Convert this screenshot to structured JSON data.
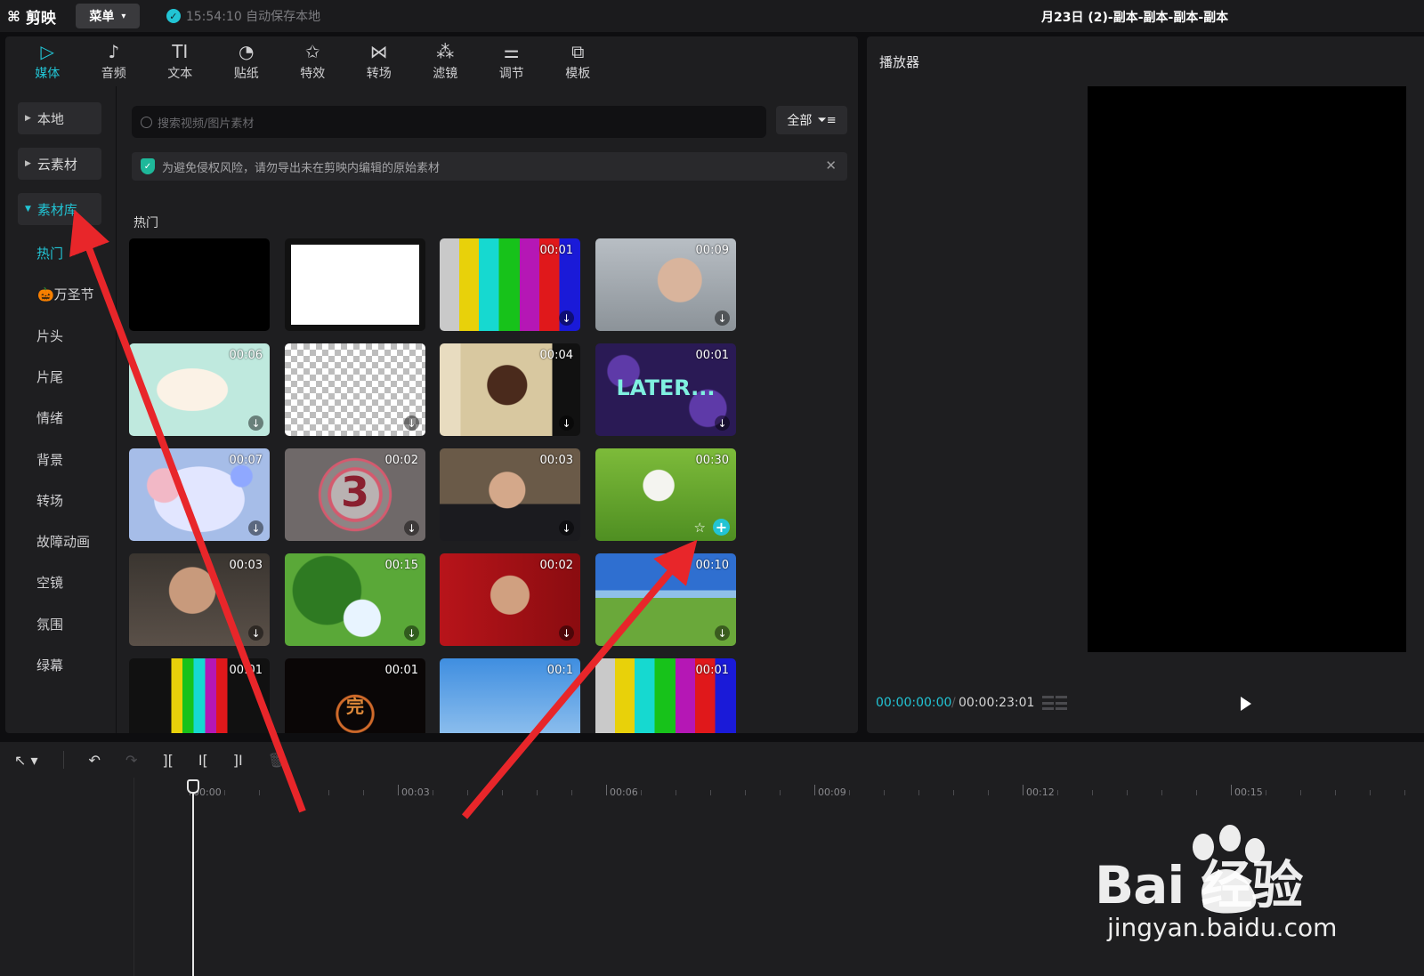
{
  "app": {
    "logo_text": "剪映",
    "menu_label": "菜单",
    "autosave_text": "15:54:10 自动保存本地",
    "project_title": "月23日 (2)-副本-副本-副本-副本"
  },
  "toolbar": {
    "tabs": [
      {
        "label": "媒体",
        "icon": "media-icon",
        "glyph": "▷"
      },
      {
        "label": "音频",
        "icon": "audio-icon",
        "glyph": "♪"
      },
      {
        "label": "文本",
        "icon": "text-icon",
        "glyph": "TI"
      },
      {
        "label": "贴纸",
        "icon": "sticker-icon",
        "glyph": "◔"
      },
      {
        "label": "特效",
        "icon": "effects-icon",
        "glyph": "✩"
      },
      {
        "label": "转场",
        "icon": "transition-icon",
        "glyph": "⋈"
      },
      {
        "label": "滤镜",
        "icon": "filter-icon",
        "glyph": "⁂"
      },
      {
        "label": "调节",
        "icon": "adjust-icon",
        "glyph": "⚌"
      },
      {
        "label": "模板",
        "icon": "template-icon",
        "glyph": "⧉"
      }
    ],
    "active_tab": "媒体"
  },
  "sidebar": {
    "top_items": [
      "本地",
      "云素材",
      "素材库"
    ],
    "active_top": "素材库",
    "sub_items": [
      "热门",
      "🎃万圣节",
      "片头",
      "片尾",
      "情绪",
      "背景",
      "转场",
      "故障动画",
      "空镜",
      "氛围",
      "绿幕"
    ],
    "active_sub": "热门"
  },
  "library": {
    "search_placeholder": "搜索视频/图片素材",
    "filter_label": "全部",
    "notice_text": "为避免侵权风险，请勿导出未在剪映内编辑的原始素材",
    "section_title": "热门",
    "thumbnails": [
      {
        "duration": "",
        "style": "black",
        "download": false
      },
      {
        "duration": "",
        "style": "white",
        "download": false
      },
      {
        "duration": "00:01",
        "style": "colorbars",
        "download": true
      },
      {
        "duration": "00:09",
        "style": "man-gray",
        "download": true
      },
      {
        "duration": "00:06",
        "style": "paper-mint",
        "download": true
      },
      {
        "duration": "",
        "style": "checker",
        "download": true
      },
      {
        "duration": "00:04",
        "style": "man-laugh",
        "download": true
      },
      {
        "duration": "00:01",
        "style": "later",
        "download": true,
        "caption": "LATER..."
      },
      {
        "duration": "00:07",
        "style": "bubbles",
        "download": true
      },
      {
        "duration": "00:02",
        "style": "countdown",
        "download": true,
        "caption": "3"
      },
      {
        "duration": "00:03",
        "style": "office-man",
        "download": true
      },
      {
        "duration": "00:30",
        "style": "dandelion",
        "download": false,
        "favorite": true,
        "add": true
      },
      {
        "duration": "00:03",
        "style": "laugh-old",
        "download": true
      },
      {
        "duration": "00:15",
        "style": "trees",
        "download": true
      },
      {
        "duration": "00:02",
        "style": "red-stage",
        "download": true
      },
      {
        "duration": "00:10",
        "style": "meadow",
        "download": true
      },
      {
        "duration": "00:01",
        "style": "colorbars-v",
        "download": false
      },
      {
        "duration": "00:01",
        "style": "end",
        "download": false,
        "caption": "完"
      },
      {
        "duration": "00:1",
        "style": "sky-hands",
        "download": false
      },
      {
        "duration": "00:01",
        "style": "colorbars-wide",
        "download": false
      }
    ]
  },
  "player": {
    "title": "播放器",
    "current_time": "00:00:00:00",
    "total_time": "00:00:23:01"
  },
  "timeline": {
    "ruler_labels": [
      "00:00",
      "00:03",
      "00:06",
      "00:09",
      "00:12",
      "00:15"
    ]
  },
  "watermark": {
    "brand": "Bai  经验",
    "url": "jingyan.baidu.com"
  },
  "colors": {
    "accent": "#22c4d4",
    "arrow": "#e8262a",
    "panel": "#1e1e20"
  }
}
